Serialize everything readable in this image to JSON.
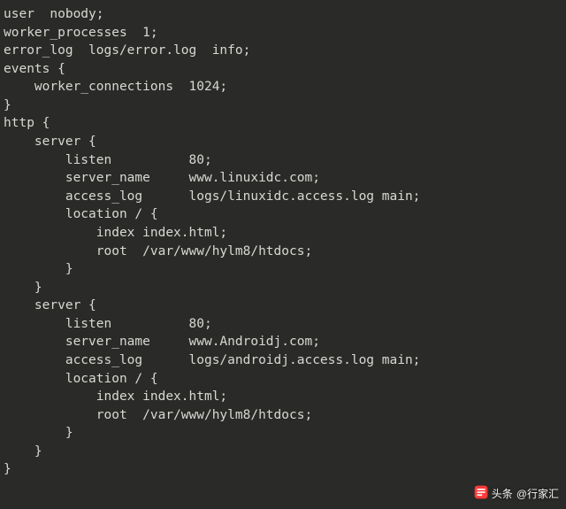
{
  "code": {
    "l01": "user  nobody;",
    "l02": "worker_processes  1;",
    "l03": "error_log  logs/error.log  info;",
    "l04": "events {",
    "l05": "    worker_connections  1024;",
    "l06": "}",
    "l07": "http {",
    "l08": "    server {",
    "l09": "        listen          80;",
    "l10": "        server_name     www.linuxidc.com;",
    "l11": "        access_log      logs/linuxidc.access.log main;",
    "l12": "        location / {",
    "l13": "            index index.html;",
    "l14": "            root  /var/www/hylm8/htdocs;",
    "l15": "        }",
    "l16": "    }",
    "l17": "    server {",
    "l18": "        listen          80;",
    "l19": "        server_name     www.Androidj.com;",
    "l20": "        access_log      logs/androidj.access.log main;",
    "l21": "        location / {",
    "l22": "            index index.html;",
    "l23": "            root  /var/www/hylm8/htdocs;",
    "l24": "        }",
    "l25": "    }",
    "l26": "}"
  },
  "watermark": {
    "prefix": "头条",
    "author": "@行家汇"
  }
}
